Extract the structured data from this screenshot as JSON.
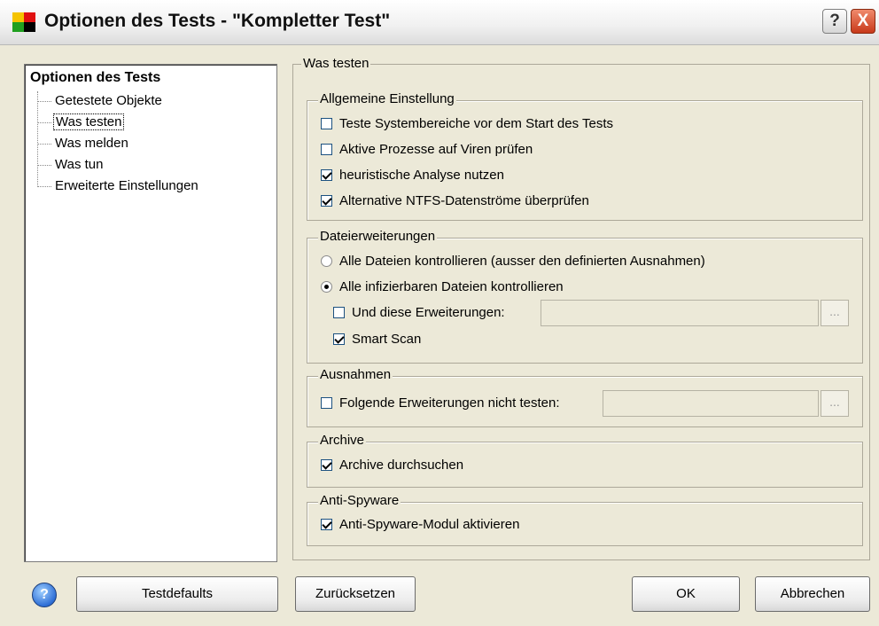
{
  "window": {
    "title": "Optionen des Tests - \"Kompletter Test\"",
    "help_glyph": "?",
    "close_glyph": "X"
  },
  "tree": {
    "root": "Optionen des Tests",
    "items": [
      {
        "label": "Getestete Objekte",
        "selected": false
      },
      {
        "label": "Was testen",
        "selected": true
      },
      {
        "label": "Was melden",
        "selected": false
      },
      {
        "label": "Was tun",
        "selected": false
      },
      {
        "label": "Erweiterte Einstellungen",
        "selected": false
      }
    ]
  },
  "pane": {
    "title": "Was testen",
    "general": {
      "label": "Allgemeine Einstellung",
      "options": [
        {
          "label": "Teste Systembereiche vor dem Start des Tests",
          "checked": false
        },
        {
          "label": "Aktive Prozesse auf Viren prüfen",
          "checked": false
        },
        {
          "label": "heuristische Analyse nutzen",
          "checked": true
        },
        {
          "label": "Alternative NTFS-Datenströme überprüfen",
          "checked": true
        }
      ]
    },
    "extensions": {
      "label": "Dateierweiterungen",
      "radio_all": "Alle Dateien kontrollieren (ausser den definierten Ausnahmen)",
      "radio_infectable": "Alle infizierbaren Dateien kontrollieren",
      "selected": "infectable",
      "and_these": {
        "label": "Und diese Erweiterungen:",
        "checked": false,
        "value": ""
      },
      "smart_scan": {
        "label": "Smart Scan",
        "checked": true
      }
    },
    "exclusions": {
      "label": "Ausnahmen",
      "skip_ext": {
        "label": "Folgende Erweiterungen nicht testen:",
        "checked": false,
        "value": ""
      }
    },
    "archives": {
      "label": "Archive",
      "search": {
        "label": "Archive durchsuchen",
        "checked": true
      }
    },
    "antispyware": {
      "label": "Anti-Spyware",
      "enable": {
        "label": "Anti-Spyware-Modul aktivieren",
        "checked": true
      }
    },
    "browse_label": "..."
  },
  "buttons": {
    "help": "?",
    "defaults": "Testdefaults",
    "reset": "Zurücksetzen",
    "ok": "OK",
    "cancel": "Abbrechen"
  },
  "colors": {
    "dialog_bg": "#ece9d8",
    "close_red": "#c8391a",
    "help_blue": "#2f6fd6"
  }
}
